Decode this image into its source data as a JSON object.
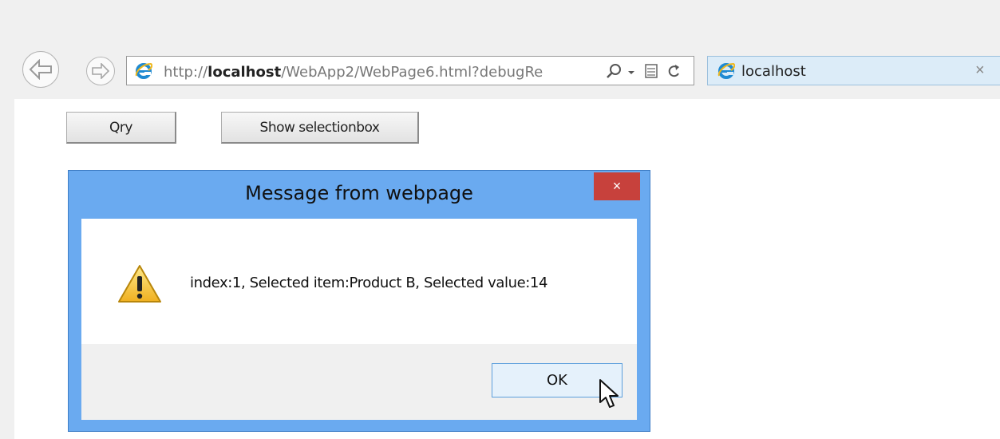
{
  "browser": {
    "url_prefix": "http://",
    "url_host": "localhost",
    "url_path": "/WebApp2/WebPage6.html?debugRe",
    "search_icon": "search-icon",
    "dropdown_icon": "chevron-down-icon",
    "compat_icon": "compat-view-icon",
    "refresh_icon": "refresh-icon",
    "tab_title": "localhost",
    "tab_close": "×"
  },
  "page": {
    "buttons": {
      "qry_label": "Qry",
      "show_label": "Show selectionbox"
    }
  },
  "dialog": {
    "title": "Message from webpage",
    "close_label": "×",
    "message": "index:1, Selected item:Product B, Selected value:14",
    "ok_label": "OK",
    "warning_icon": "warning-icon"
  },
  "colors": {
    "dialog_frame": "#6aaaf0",
    "close_button": "#c7413c",
    "tab_background": "#dcecf8"
  }
}
